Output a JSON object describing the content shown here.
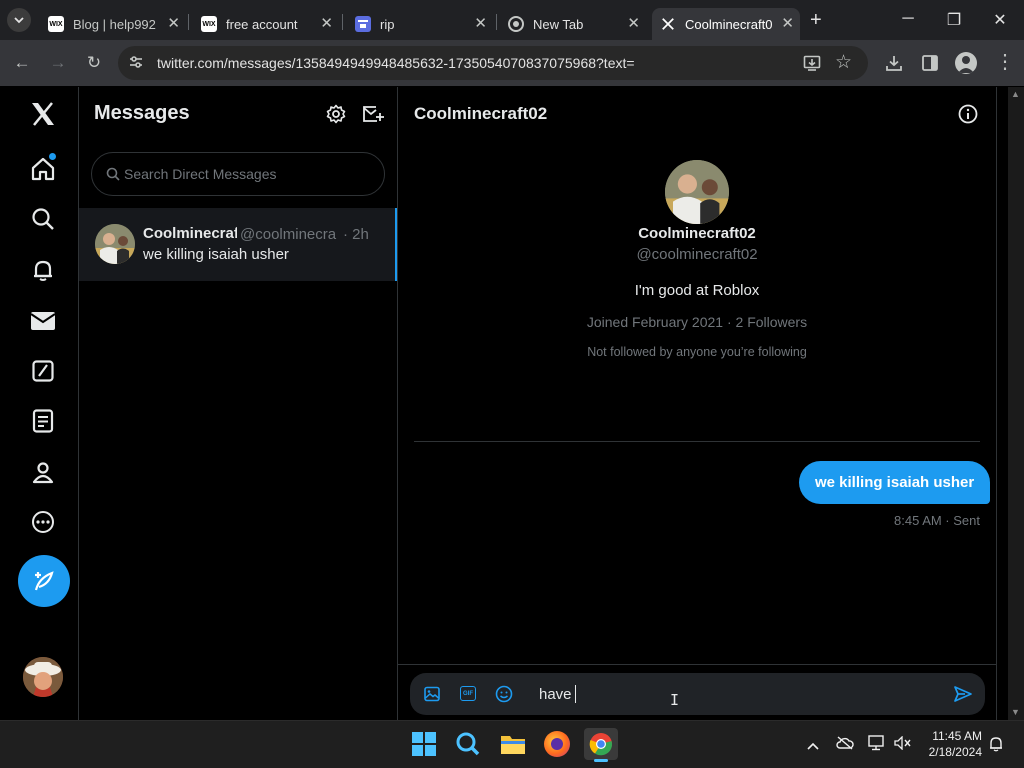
{
  "browser": {
    "tabs": [
      {
        "title": "Blog | help992",
        "favicon": "wix-favicon"
      },
      {
        "title": "free account",
        "favicon": "wix-favicon"
      },
      {
        "title": "rip",
        "favicon": "forms-favicon"
      },
      {
        "title": "New Tab",
        "favicon": "chrome-favicon"
      },
      {
        "title": "Coolminecraft0",
        "favicon": "x-favicon",
        "active": true
      }
    ],
    "url": "twitter.com/messages/1358494949948485632-1735054070837075968?text="
  },
  "nav": {
    "icons": [
      "x-logo-icon",
      "home-icon",
      "search-icon",
      "bell-icon",
      "mail-icon",
      "grok-icon",
      "lists-icon",
      "profile-icon",
      "more-icon",
      "compose-post-icon"
    ]
  },
  "messages": {
    "title": "Messages",
    "search_placeholder": "Search Direct Messages",
    "conversation": {
      "name": "Coolminecraf",
      "handle": "@coolminecra",
      "time": "· 2h",
      "preview": "we killing isaiah usher"
    }
  },
  "chat": {
    "header_name": "Coolminecraft02",
    "profile": {
      "name": "Coolminecraft02",
      "handle": "@coolminecraft02",
      "bio": "I'm good at Roblox",
      "joined": "Joined February 2021 · 2 Followers",
      "followed_note": "Not followed by anyone you’re following"
    },
    "message": {
      "text": "we killing isaiah usher",
      "meta": "8:45 AM · Sent"
    },
    "composer_text": "have"
  },
  "taskbar": {
    "time": "11:45 AM",
    "date": "2/18/2024"
  },
  "colors": {
    "accent": "#1d9bf0",
    "background": "#000000",
    "border": "#2f3336",
    "muted_text": "#71767b"
  }
}
